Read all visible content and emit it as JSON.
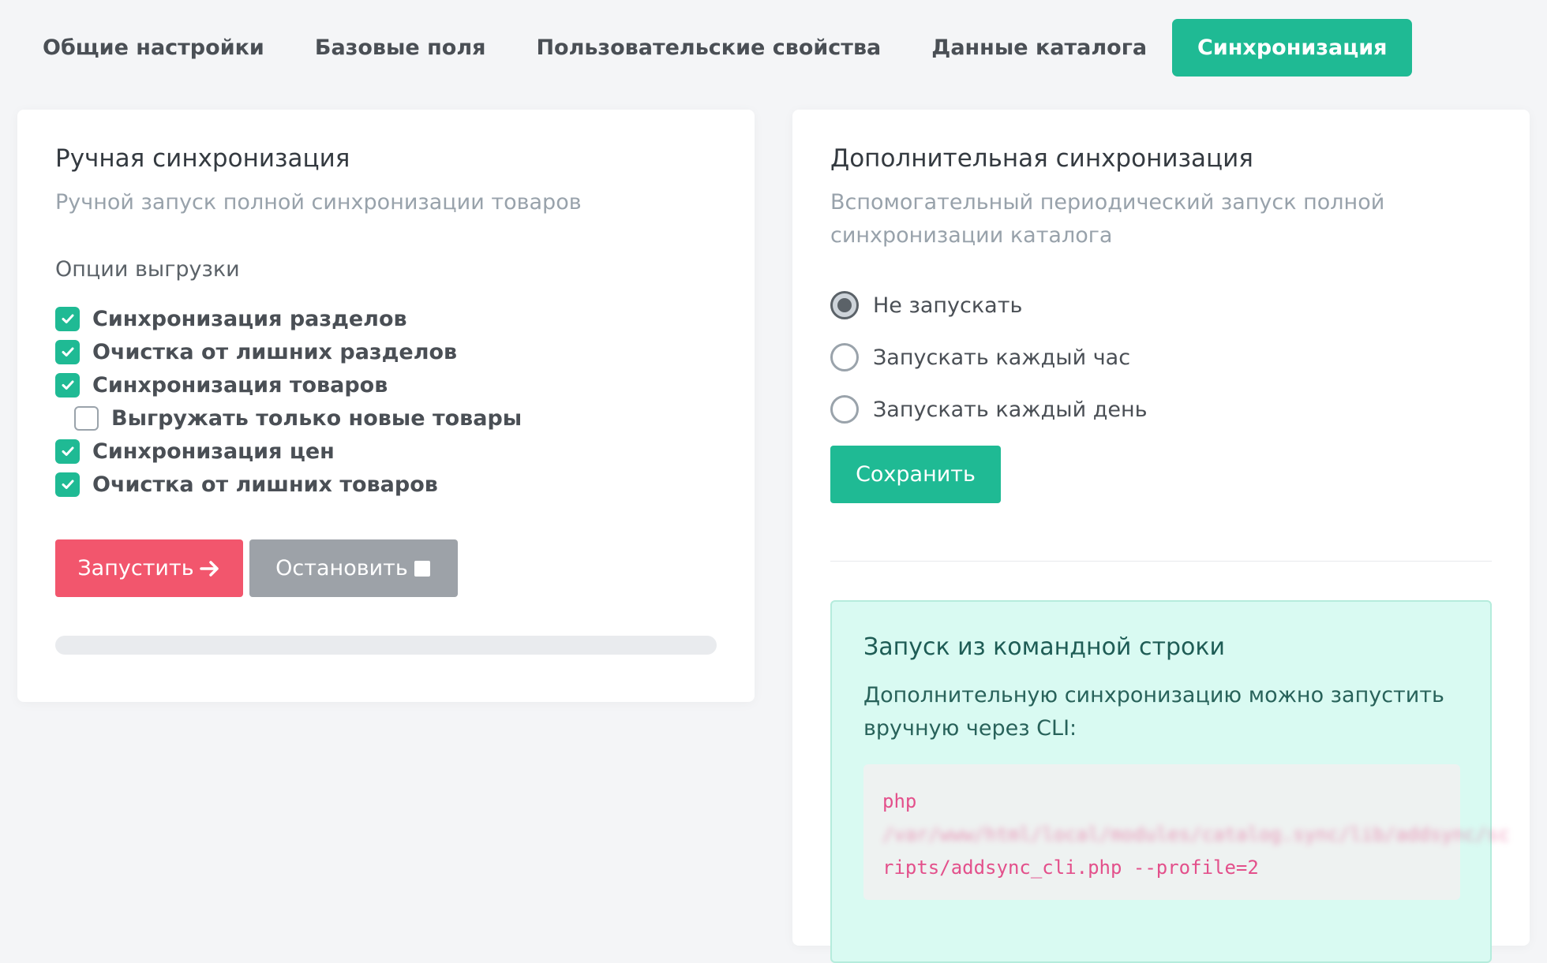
{
  "tabs": [
    {
      "label": "Общие настройки",
      "active": false
    },
    {
      "label": "Базовые поля",
      "active": false
    },
    {
      "label": "Пользовательские свойства",
      "active": false
    },
    {
      "label": "Данные каталога",
      "active": false
    },
    {
      "label": "Синхронизация",
      "active": true
    }
  ],
  "manual": {
    "title": "Ручная синхронизация",
    "subtitle": "Ручной запуск полной синхронизации товаров",
    "options_label": "Опции выгрузки",
    "options": [
      {
        "label": "Синхронизация разделов",
        "checked": true
      },
      {
        "label": "Очистка от лишних разделов",
        "checked": true
      },
      {
        "label": "Синхронизация товаров",
        "checked": true
      },
      {
        "label": "Выгружать только новые товары",
        "checked": false
      },
      {
        "label": "Синхронизация цен",
        "checked": true
      },
      {
        "label": "Очистка от лишних товаров",
        "checked": true
      }
    ],
    "start_label": "Запустить",
    "start_icon": "arrow-right-icon",
    "stop_label": "Остановить",
    "stop_icon": "stop-square-icon",
    "progress": 0
  },
  "additional": {
    "title": "Дополнительная синхронизация",
    "subtitle": "Вспомогательный периодический запуск полной синхронизации каталога",
    "radio_options": [
      {
        "label": "Не запускать",
        "checked": true
      },
      {
        "label": "Запускать каждый час",
        "checked": false
      },
      {
        "label": "Запускать каждый день",
        "checked": false
      }
    ],
    "save_label": "Сохранить"
  },
  "cli": {
    "title": "Запуск из командной строки",
    "text": "Дополнительную синхронизацию можно запустить вручную через CLI:",
    "code_line1": "php",
    "code_line2_blurred": "/var/www/html/local/modules/catalog.sync/lib/addsync/sc",
    "code_line3": "ripts/addsync_cli.php --profile=2"
  },
  "colors": {
    "accent": "#1fba94",
    "danger": "#f2566d",
    "secondary": "#9da2a8",
    "code_text": "#e3508b",
    "info_bg": "#d9faf2"
  }
}
